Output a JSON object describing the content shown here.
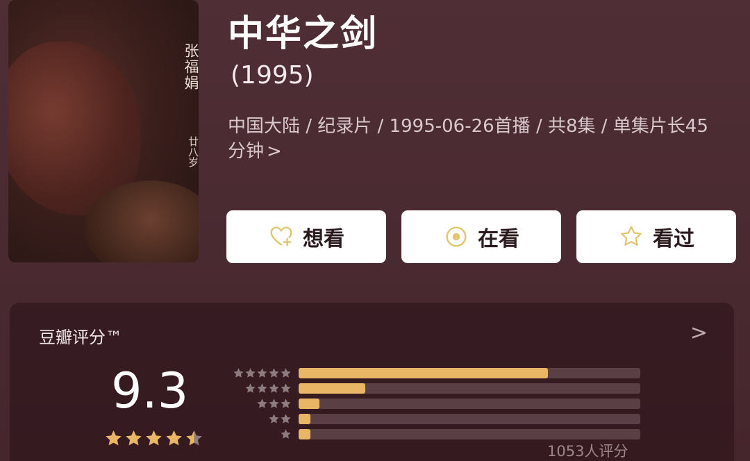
{
  "poster": {
    "name_vertical": "张福娟",
    "age_vertical": "廿八岁"
  },
  "movie": {
    "title": "中华之剑",
    "year": "(1995)",
    "meta_line": "中国大陆 / 纪录片 / 1995-06-26首播 / 共8集 / 单集片长45分钟",
    "meta_arrow": ">"
  },
  "actions": [
    {
      "label": "想看",
      "icon": "heart-plus-icon"
    },
    {
      "label": "在看",
      "icon": "circle-dot-icon"
    },
    {
      "label": "看过",
      "icon": "star-outline-icon"
    }
  ],
  "rating": {
    "label": "豆瓣评分™",
    "chevron": ">",
    "score": "9.3",
    "stars": 4.5,
    "count_text": "1053人评分",
    "distribution_fraction": [
      0.73,
      0.195,
      0.06,
      0.035,
      0.035
    ],
    "colors": {
      "accent": "#e9b665",
      "track": "#5a3f44",
      "star_dim": "#8e7b80"
    }
  }
}
